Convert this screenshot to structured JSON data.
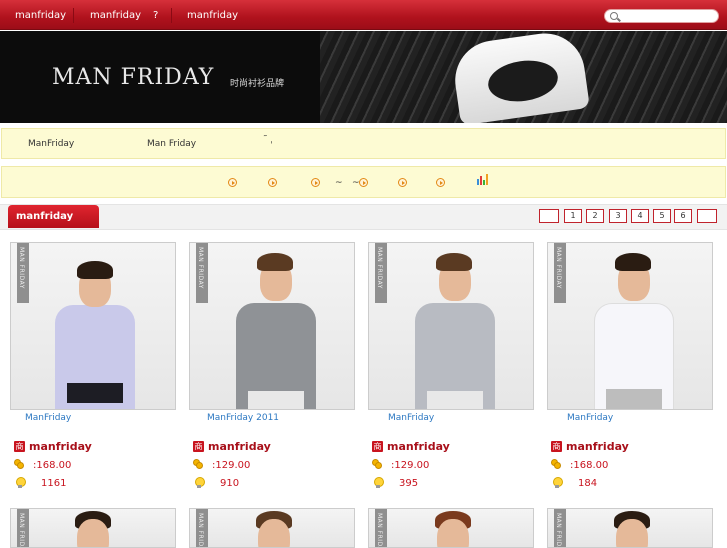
{
  "topnav": {
    "links": [
      "manfriday",
      "manfriday",
      "?",
      "manfriday"
    ]
  },
  "banner": {
    "brand": "MAN FRIDAY",
    "slogan": "时尚衬衫品牌"
  },
  "infobar": {
    "left_text": "ManFriday",
    "mid_text": "Man Friday",
    "right_text": "˜ ˌ",
    "tilde_left": "~",
    "tilde_right": "~"
  },
  "section": {
    "title": "manfriday",
    "pages": [
      "",
      "1",
      "2",
      "3",
      "4",
      "5",
      "6",
      ""
    ]
  },
  "products": [
    {
      "caption": "ManFriday",
      "shop": "manfriday",
      "price": ":168.00",
      "views": "1161",
      "shirt": "#c9c9ea",
      "tag": "MAN FRIDAY"
    },
    {
      "caption": "ManFriday  2011",
      "shop": "manfriday",
      "price": ":129.00",
      "views": "910",
      "shirt": "#8f9296",
      "tag": "MAN FRIDAY"
    },
    {
      "caption": "ManFriday",
      "shop": "manfriday",
      "price": ":129.00",
      "views": "395",
      "shirt": "#b8bbc2",
      "tag": "MAN FRIDAY"
    },
    {
      "caption": "ManFriday",
      "shop": "manfriday",
      "price": ":168.00",
      "views": "184",
      "shirt": "#f6f6fa",
      "tag": "MAN FRIDAY"
    }
  ],
  "icons": {
    "shop": "shop-badge-icon",
    "shop_glyph": "商",
    "price": "coins-icon",
    "views": "lightbulb-icon",
    "search": "search-icon",
    "bullet": "play-circle-icon",
    "stats": "bar-chart-icon"
  },
  "colors": {
    "nav_red": "#b0121d",
    "link_blue": "#2c78c2",
    "price_red": "#c8141f",
    "notice_yellow": "#fdfbd3"
  }
}
